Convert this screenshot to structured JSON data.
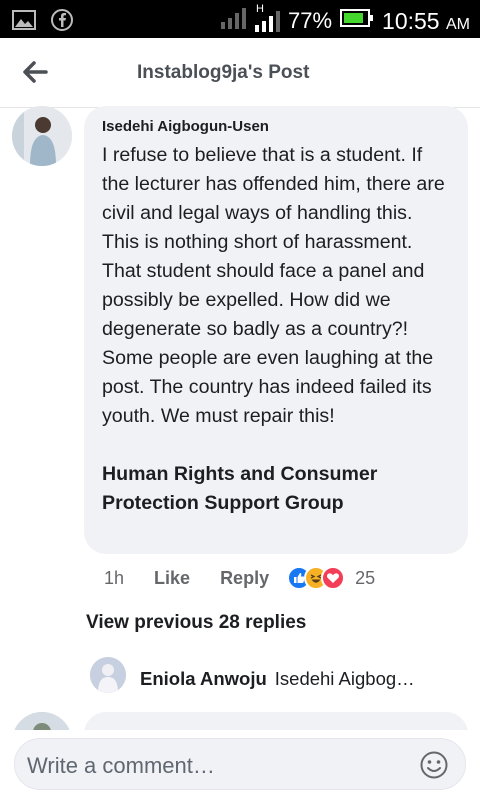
{
  "status_bar": {
    "signal_label": "H",
    "battery_percent": "77%",
    "time": "10:55",
    "ampm": "AM"
  },
  "header": {
    "title": "Instablog9ja's Post"
  },
  "comment": {
    "author": "Isedehi Aigbogun-Usen",
    "text": "I refuse to believe that is a student. If the lecturer has offended him, there are civil and legal ways of handling this. This is nothing short of harassment. That student should face a panel and possibly be expelled. How did we degenerate so badly as a country?! Some people are even laughing at the post. The country has indeed failed its youth. We must repair this!",
    "group": "Human Rights and Consumer Protection Support Group",
    "time": "1h",
    "like_label": "Like",
    "reply_label": "Reply",
    "reaction_count": "25"
  },
  "replies": {
    "view_previous": "View previous 28 replies",
    "preview": {
      "author": "Eniola Anwoju",
      "text": "Isedehi Aigbog…"
    }
  },
  "composer": {
    "placeholder": "Write a comment…"
  },
  "colors": {
    "like": "#1877f2",
    "haha": "#f7b125",
    "love": "#f33e58",
    "bubble": "#f1f2f6",
    "battery": "#44d62c"
  }
}
